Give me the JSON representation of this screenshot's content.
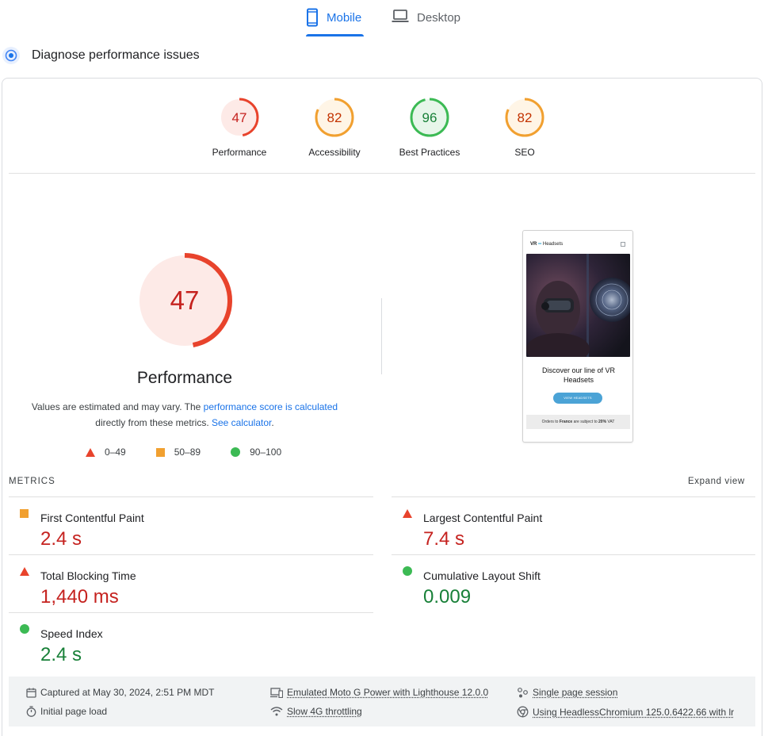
{
  "tabs": [
    {
      "label": "Mobile",
      "active": true
    },
    {
      "label": "Desktop",
      "active": false
    }
  ],
  "section_title": "Diagnose performance issues",
  "categories": [
    {
      "score": "47",
      "label": "Performance",
      "color": "#e8432c",
      "bg": "#fdeae7",
      "fraction": 0.47
    },
    {
      "score": "82",
      "label": "Accessibility",
      "color": "#f1a030",
      "bg": "#fff5e6",
      "fraction": 0.82
    },
    {
      "score": "96",
      "label": "Best Practices",
      "color": "#3cba54",
      "bg": "#e7f6ea",
      "fraction": 0.96
    },
    {
      "score": "82",
      "label": "SEO",
      "color": "#f1a030",
      "bg": "#fff5e6",
      "fraction": 0.82
    }
  ],
  "main": {
    "score": "47",
    "title": "Performance",
    "desc_1": "Values are estimated and may vary. The ",
    "desc_link_1": "performance score is calculated",
    "desc_2": "directly from these metrics. ",
    "desc_link_2": "See calculator",
    "desc_3": "."
  },
  "legend": [
    {
      "shape": "triangle",
      "color": "#e8432c",
      "label": "0–49"
    },
    {
      "shape": "square",
      "color": "#f1a030",
      "label": "50–89"
    },
    {
      "shape": "circle",
      "color": "#3cba54",
      "label": "90–100"
    }
  ],
  "phone": {
    "brand_a": "VR",
    "brand_dots": "••",
    "brand_b": "Headsets",
    "heading": "Discover our line of VR Headsets",
    "button": "VIEW HEADSETS",
    "footer_a": "Orders to ",
    "footer_b": "France",
    "footer_c": " are subject to ",
    "footer_d": "20%",
    "footer_e": " VAT"
  },
  "metrics": {
    "header": "METRICS",
    "expand": "Expand view",
    "items": [
      {
        "name": "First Contentful Paint",
        "value": "2.4 s",
        "rating": "average"
      },
      {
        "name": "Largest Contentful Paint",
        "value": "7.4 s",
        "rating": "fail"
      },
      {
        "name": "Total Blocking Time",
        "value": "1,440 ms",
        "rating": "fail"
      },
      {
        "name": "Cumulative Layout Shift",
        "value": "0.009",
        "rating": "pass"
      },
      {
        "name": "Speed Index",
        "value": "2.4 s",
        "rating": "pass"
      }
    ]
  },
  "info": {
    "captured": "Captured at May 30, 2024, 2:51 PM MDT",
    "load": "Initial page load",
    "device": "Emulated Moto G Power with Lighthouse 12.0.0",
    "throttle": "Slow 4G throttling",
    "session": "Single page session",
    "browser": "Using HeadlessChromium 125.0.6422.66 with lr"
  }
}
